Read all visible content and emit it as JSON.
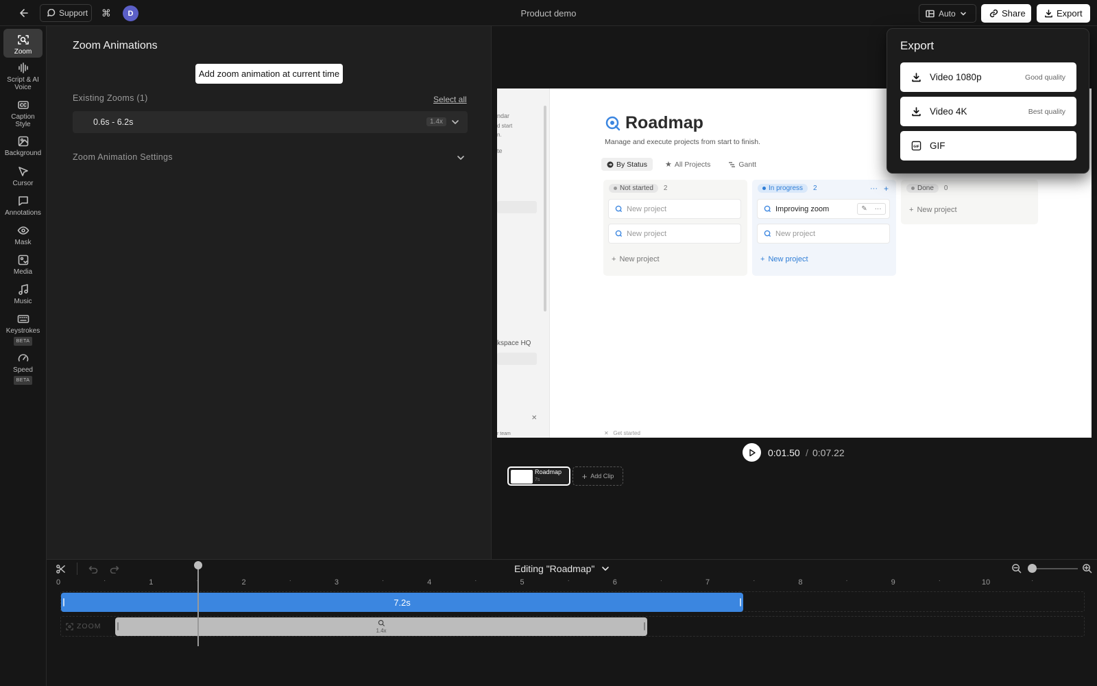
{
  "topbar": {
    "support_label": "Support",
    "avatar_initial": "D",
    "document_title": "Product demo",
    "aspect_label": "Auto",
    "share_label": "Share",
    "export_label": "Export"
  },
  "sidebar": {
    "items": [
      {
        "label": "Zoom",
        "icon": "zoom-icon",
        "active": true
      },
      {
        "label": "Script & AI Voice",
        "icon": "waveform-icon"
      },
      {
        "label": "Caption Style",
        "icon": "captions-icon"
      },
      {
        "label": "Background",
        "icon": "image-icon"
      },
      {
        "label": "Cursor",
        "icon": "cursor-icon"
      },
      {
        "label": "Annotations",
        "icon": "comment-icon"
      },
      {
        "label": "Mask",
        "icon": "eye-icon"
      },
      {
        "label": "Media",
        "icon": "media-icon"
      },
      {
        "label": "Music",
        "icon": "music-icon"
      },
      {
        "label": "Keystrokes",
        "icon": "keyboard-icon",
        "badge": "BETA"
      },
      {
        "label": "Speed",
        "icon": "speedometer-icon",
        "badge": "BETA"
      }
    ]
  },
  "zoom_panel": {
    "title": "Zoom Animations",
    "add_button_label": "Add zoom animation at current time",
    "existing_label": "Existing Zooms (1)",
    "select_all_label": "Select all",
    "zooms": [
      {
        "range": "0.6s - 6.2s",
        "multiplier": "1.4x"
      }
    ],
    "settings_label": "Zoom Animation Settings"
  },
  "export_menu": {
    "title": "Export",
    "options": [
      {
        "name": "Video 1080p",
        "quality": "Good quality",
        "icon": "download-icon"
      },
      {
        "name": "Video 4K",
        "quality": "Best quality",
        "icon": "download-icon"
      },
      {
        "name": "GIF",
        "quality": "",
        "icon": "gif-icon"
      }
    ]
  },
  "canvas": {
    "side_texts": [
      "ndar",
      "d start",
      "n.",
      "te",
      "kspace HQ",
      "r team"
    ],
    "title": "Roadmap",
    "subtitle": "Manage and execute projects from start to finish.",
    "tabs": [
      "By Status",
      "All Projects",
      "Gantt"
    ],
    "columns": [
      {
        "status": "Not started",
        "count": "2",
        "cards": [
          "New project",
          "New project"
        ],
        "new_label": "New project"
      },
      {
        "status": "In progress",
        "count": "2",
        "cards": [
          "Improving zoom",
          "New project"
        ],
        "new_label": "New project"
      },
      {
        "status": "Done",
        "count": "0",
        "cards": [],
        "new_label": "New project"
      }
    ],
    "footer": "Get started"
  },
  "playback": {
    "current_time": "0:01.50",
    "separator": "/",
    "total_time": "0:07.22"
  },
  "clips": {
    "clip_name": "Roadmap",
    "clip_duration": "7s",
    "add_clip_label": "Add Clip"
  },
  "timeline": {
    "title": "Editing \"Roadmap\"",
    "ticks": [
      "0",
      "1",
      "2",
      "3",
      "4",
      "5",
      "6",
      "7",
      "8",
      "9",
      "10"
    ],
    "clip_duration_label": "7.2s",
    "zoom_track_label": "ZOOM",
    "zoom_multiplier": "1.4x",
    "playhead_time": 1.5,
    "zoom_start": 0.6,
    "zoom_end": 6.2
  },
  "colors": {
    "accent_blue": "#3b86e0",
    "avatar": "#5b5fc7",
    "in_progress": "#2e7dd6"
  }
}
